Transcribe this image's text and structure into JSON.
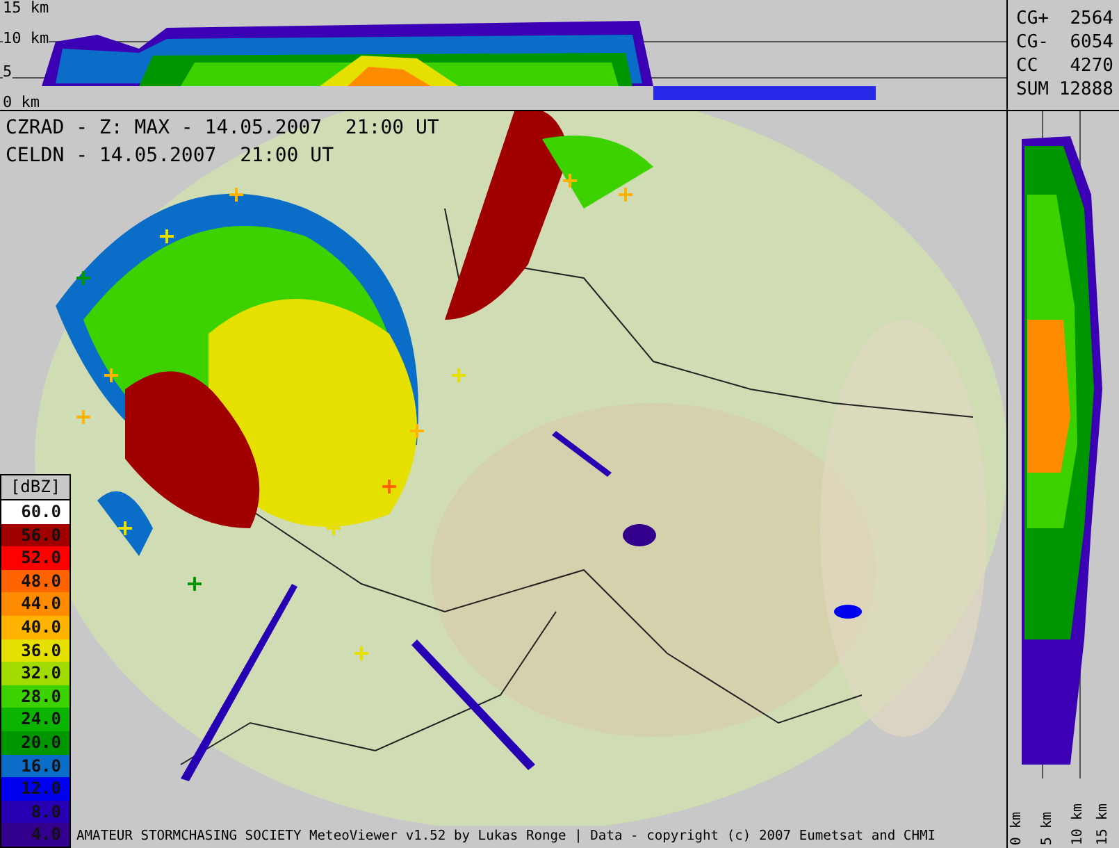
{
  "top_profile": {
    "height_labels": [
      "15 km",
      "10 km",
      "5",
      "0 km"
    ]
  },
  "lightning_stats": [
    {
      "label": "CG+",
      "value": "2564"
    },
    {
      "label": "CG-",
      "value": "6054"
    },
    {
      "label": "CC",
      "value": "4270"
    },
    {
      "label": "SUM",
      "value": "12888"
    }
  ],
  "map": {
    "product_lines": [
      "CZRAD - Z: MAX - 14.05.2007  21:00 UT",
      "CELDN - 14.05.2007  21:00 UT"
    ],
    "legend": {
      "title": "[dBZ]",
      "entries": [
        {
          "label": "60.0",
          "color": "#ffffff"
        },
        {
          "label": "56.0",
          "color": "#a00000"
        },
        {
          "label": "52.0",
          "color": "#ff0000"
        },
        {
          "label": "48.0",
          "color": "#ff6400"
        },
        {
          "label": "44.0",
          "color": "#ff8c00"
        },
        {
          "label": "40.0",
          "color": "#ffb400"
        },
        {
          "label": "36.0",
          "color": "#e6e000"
        },
        {
          "label": "32.0",
          "color": "#a0dc00"
        },
        {
          "label": "28.0",
          "color": "#3cd200"
        },
        {
          "label": "24.0",
          "color": "#0ab400"
        },
        {
          "label": "20.0",
          "color": "#009600"
        },
        {
          "label": "16.0",
          "color": "#0a6ec8"
        },
        {
          "label": "12.0",
          "color": "#0000f0"
        },
        {
          "label": "8.0",
          "color": "#2800b4"
        },
        {
          "label": "4.0",
          "color": "#32008c"
        }
      ]
    },
    "footer": "AMATEUR STORMCHASING SOCIETY MeteoViewer v1.52 by Lukas Ronge | Data - copyright (c) 2007 Eumetsat and CHMI"
  },
  "side_profile": {
    "height_labels": [
      "0 km",
      "5 km",
      "10 km",
      "15 km"
    ]
  }
}
